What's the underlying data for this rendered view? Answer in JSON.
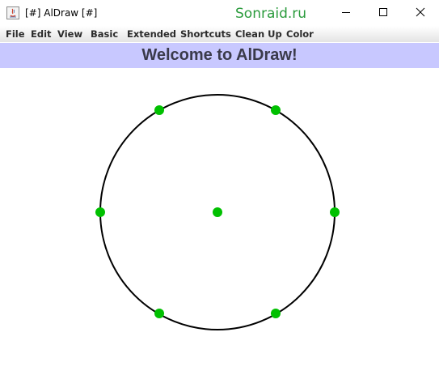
{
  "window": {
    "title": "[#] AlDraw [#]",
    "watermark": "Sonraid.ru",
    "watermark_color": "#2a9b3c"
  },
  "menu": {
    "items": [
      "File",
      "Edit",
      "View",
      "Basic",
      "Extended",
      "Shortcuts",
      "Clean Up",
      "Color"
    ]
  },
  "banner": {
    "text": "Welcome to AlDraw!",
    "background": "#c8c8ff"
  },
  "drawing": {
    "shape": "circle",
    "stroke_color": "#000000",
    "point_color": "#00c000",
    "points": [
      "center",
      "top-left",
      "top-right",
      "left",
      "right",
      "bottom-left",
      "bottom-right"
    ]
  }
}
